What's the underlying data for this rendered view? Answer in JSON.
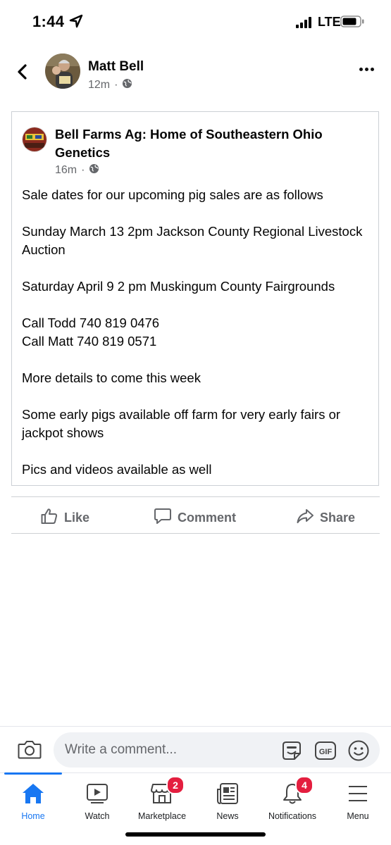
{
  "status_bar": {
    "time": "1:44",
    "carrier": "LTE"
  },
  "header": {
    "author_name": "Matt Bell",
    "author_time": "12m"
  },
  "shared_post": {
    "page_name": "Bell Farms Ag:  Home of Southeastern Ohio Genetics",
    "time": "16m",
    "paragraphs": [
      "Sale dates for our upcoming pig sales are as follows",
      "Sunday March 13 2pm Jackson County Regional Livestock Auction",
      "Saturday April 9 2 pm Muskingum County Fairgrounds",
      "Call Todd 740 819 0476\nCall Matt 740 819 0571",
      "More details to come this week",
      "Some early pigs available off farm for very early fairs or jackpot shows",
      "Pics and videos available as well"
    ]
  },
  "actions": {
    "like": "Like",
    "comment": "Comment",
    "share": "Share"
  },
  "comment_bar": {
    "placeholder": "Write a comment...",
    "gif_label": "GIF"
  },
  "nav": {
    "home": "Home",
    "watch": "Watch",
    "marketplace": "Marketplace",
    "marketplace_badge": "2",
    "news": "News",
    "notifications": "Notifications",
    "notifications_badge": "4",
    "menu": "Menu"
  },
  "colors": {
    "accent": "#1877f2",
    "badge": "#e41e3f",
    "secondary_text": "#65676b"
  }
}
